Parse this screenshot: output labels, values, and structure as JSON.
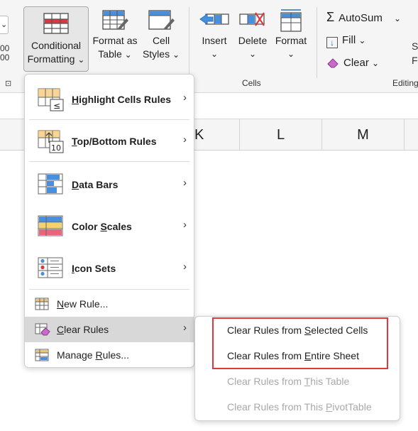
{
  "ribbon": {
    "conditional_formatting": {
      "line1": "Conditional",
      "line2": "Formatting",
      "caret": "⌄"
    },
    "format_as_table": {
      "line1": "Format as",
      "line2": "Table",
      "caret": "⌄"
    },
    "cell_styles": {
      "line1": "Cell",
      "line2": "Styles",
      "caret": "⌄"
    },
    "insert": {
      "label": "Insert",
      "caret": "⌄"
    },
    "delete": {
      "label": "Delete",
      "caret": "⌄"
    },
    "format": {
      "label": "Format",
      "caret": "⌄"
    },
    "autosum": {
      "label": "AutoSum",
      "caret": "⌄"
    },
    "fill": {
      "label": "Fill",
      "caret": "⌄"
    },
    "clear": {
      "label": "Clear",
      "caret": "⌄"
    },
    "cells_group_label": "Cells",
    "editing_group_label": "Editing",
    "partial_left": {
      "top": "",
      "mid": "00",
      "bot": "00"
    },
    "partial_right": {
      "top": "S",
      "bot": "F"
    }
  },
  "columns": [
    "K",
    "L",
    "M"
  ],
  "menu": {
    "items": [
      {
        "pre": "",
        "u": "H",
        "post": "ighlight Cells Rules",
        "icon": "highlight-cells-icon"
      },
      {
        "pre": "",
        "u": "T",
        "post": "op/Bottom Rules",
        "icon": "top-bottom-icon"
      },
      {
        "pre": "",
        "u": "D",
        "post": "ata Bars",
        "icon": "data-bars-icon"
      },
      {
        "pre": "Color ",
        "u": "S",
        "post": "cales",
        "icon": "color-scales-icon"
      },
      {
        "pre": "",
        "u": "I",
        "post": "con Sets",
        "icon": "icon-sets-icon"
      }
    ],
    "new_rule": {
      "pre": "",
      "u": "N",
      "post": "ew Rule...",
      "icon": "new-rule-icon"
    },
    "clear_rules": {
      "pre": "",
      "u": "C",
      "post": "lear Rules",
      "icon": "clear-rules-icon"
    },
    "manage_rules": {
      "pre": "Manage ",
      "u": "R",
      "post": "ules...",
      "icon": "manage-rules-icon"
    },
    "icon_sets_badge": "10",
    "chevron": "›"
  },
  "submenu": {
    "items": [
      {
        "pre": "Clear Rules from ",
        "u": "S",
        "post": "elected Cells",
        "enabled": true
      },
      {
        "pre": "Clear Rules from ",
        "u": "E",
        "post": "ntire Sheet",
        "enabled": true
      },
      {
        "pre": "Clear Rules from ",
        "u": "T",
        "post": "his Table",
        "enabled": false
      },
      {
        "pre": "Clear Rules from This ",
        "u": "P",
        "post": "ivotTable",
        "enabled": false
      }
    ]
  },
  "colors": {
    "highlight": "#e0393b",
    "accent_blue": "#1f6fd1",
    "accent_red": "#d9383d"
  }
}
